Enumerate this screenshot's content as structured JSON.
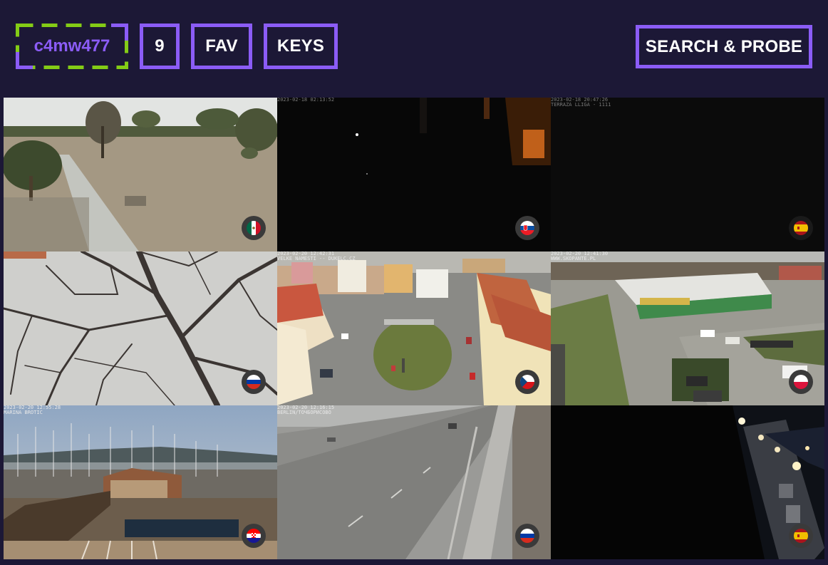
{
  "header": {
    "logo_text": "c4mw477",
    "count_badge": "9",
    "fav_label": "FAV",
    "keys_label": "KEYS",
    "search_label": "SEARCH & PROBE"
  },
  "colors": {
    "background": "#1c1836",
    "accent_purple": "#8b5cf6",
    "logo_dash_green": "#84cc16"
  },
  "cameras": [
    {
      "name": "cam-park-field",
      "osd": "",
      "flag": "Mexico"
    },
    {
      "name": "cam-night-window",
      "osd": "2023-02-18 02:13:52",
      "flag": "Slovakia"
    },
    {
      "name": "cam-dark-spain",
      "osd": "2023-02-18 20:47:26\nTERRAZA LLIGA - 1111",
      "flag": "Spain"
    },
    {
      "name": "cam-tree-branches",
      "osd": "",
      "flag": "Russia"
    },
    {
      "name": "cam-town-square",
      "osd": "2023-02-20 12:42:31\nVELKE NAMESTI -- DUKELC.CZ",
      "flag": "Czech Republic"
    },
    {
      "name": "cam-parking-lot",
      "osd": "2023-02-20 12:41:30\nWWW.SKOPANTE.PL",
      "flag": "Poland"
    },
    {
      "name": "cam-marina",
      "osd": "2023-02-20 12:55:28\nMARINA BROTIC",
      "flag": "Croatia"
    },
    {
      "name": "cam-highway",
      "osd": "2023-02-20 12:16:15\nBERLIN/TOЧБОРИСОВО",
      "flag": "Russia"
    },
    {
      "name": "cam-night-promenade",
      "osd": "",
      "flag": "Spain"
    }
  ]
}
